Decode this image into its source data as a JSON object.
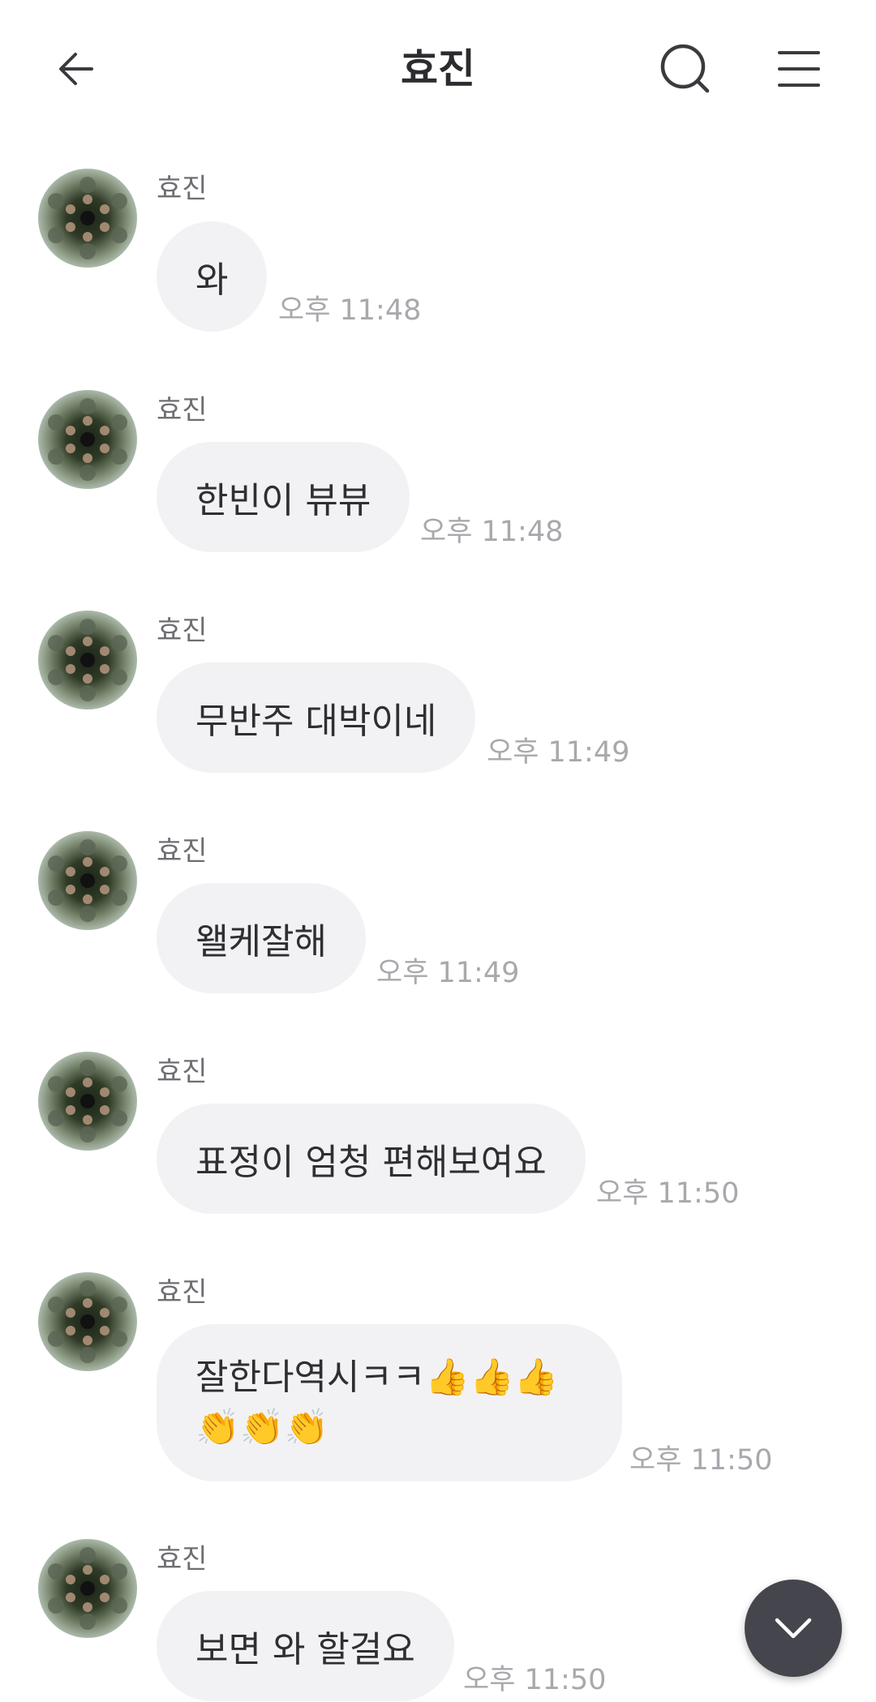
{
  "header": {
    "title": "효진",
    "back_icon": "arrow-left-icon",
    "search_icon": "search-icon",
    "menu_icon": "hamburger-menu-icon"
  },
  "messages": [
    {
      "sender": "효진",
      "text": "와",
      "time": "오후 11:48"
    },
    {
      "sender": "효진",
      "text": "한빈이 뷰뷰",
      "time": "오후 11:48"
    },
    {
      "sender": "효진",
      "text": "무반주 대박이네",
      "time": "오후 11:49"
    },
    {
      "sender": "효진",
      "text": "왤케잘해",
      "time": "오후 11:49"
    },
    {
      "sender": "효진",
      "text": "표정이 엄청 편해보여요",
      "time": "오후 11:50"
    },
    {
      "sender": "효진",
      "text": "잘한다역시ㅋㅋ👍👍👍👏👏👏",
      "time": "오후 11:50"
    },
    {
      "sender": "효진",
      "text": "보면 와 할걸요",
      "time": "오후 11:50"
    }
  ],
  "scroll_button_icon": "chevron-down-icon",
  "colors": {
    "bubble_bg": "#f2f2f4",
    "timestamp": "#a8a8ad",
    "fab_bg": "#45464d"
  }
}
